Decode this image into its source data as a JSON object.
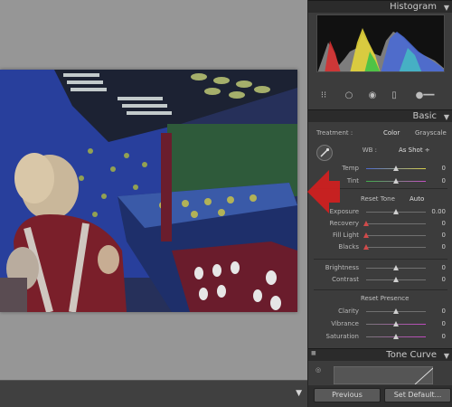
{
  "panel": {
    "histogram_title": "Histogram",
    "basic_title": "Basic",
    "tone_curve_title": "Tone Curve"
  },
  "treatment": {
    "label": "Treatment :",
    "color": "Color",
    "grayscale": "Grayscale"
  },
  "wb": {
    "label": "WB :",
    "value": "As Shot ÷"
  },
  "sliders_wb": [
    {
      "label": "Temp",
      "value": "0",
      "level": 0.5
    },
    {
      "label": "Tint",
      "value": "0",
      "level": 0.5
    }
  ],
  "reset_tone": "Reset Tone",
  "auto": "Auto",
  "sliders_tone": [
    {
      "label": "Exposure",
      "value": "0.00",
      "level": 0.5
    },
    {
      "label": "Recovery",
      "value": "0",
      "level": 0.0
    },
    {
      "label": "Fill Light",
      "value": "0",
      "level": 0.0
    },
    {
      "label": "Blacks",
      "value": "0",
      "level": 0.0
    }
  ],
  "sliders_bc": [
    {
      "label": "Brightness",
      "value": "0",
      "level": 0.5
    },
    {
      "label": "Contrast",
      "value": "0",
      "level": 0.5
    }
  ],
  "reset_presence": "Reset Presence",
  "sliders_presence": [
    {
      "label": "Clarity",
      "value": "0",
      "level": 0.5
    },
    {
      "label": "Vibrance",
      "value": "0",
      "level": 0.5
    },
    {
      "label": "Saturation",
      "value": "0",
      "level": 0.5
    }
  ],
  "buttons": {
    "previous": "Previous",
    "set_default": "Set Default..."
  },
  "icons": {
    "eyedropper": "eyedropper-icon",
    "arrow": "red-arrow-annotation"
  },
  "colors": {
    "accent_red": "#d21f1f",
    "panel_bg": "#3c3c3c",
    "workspace_bg": "#969696"
  }
}
